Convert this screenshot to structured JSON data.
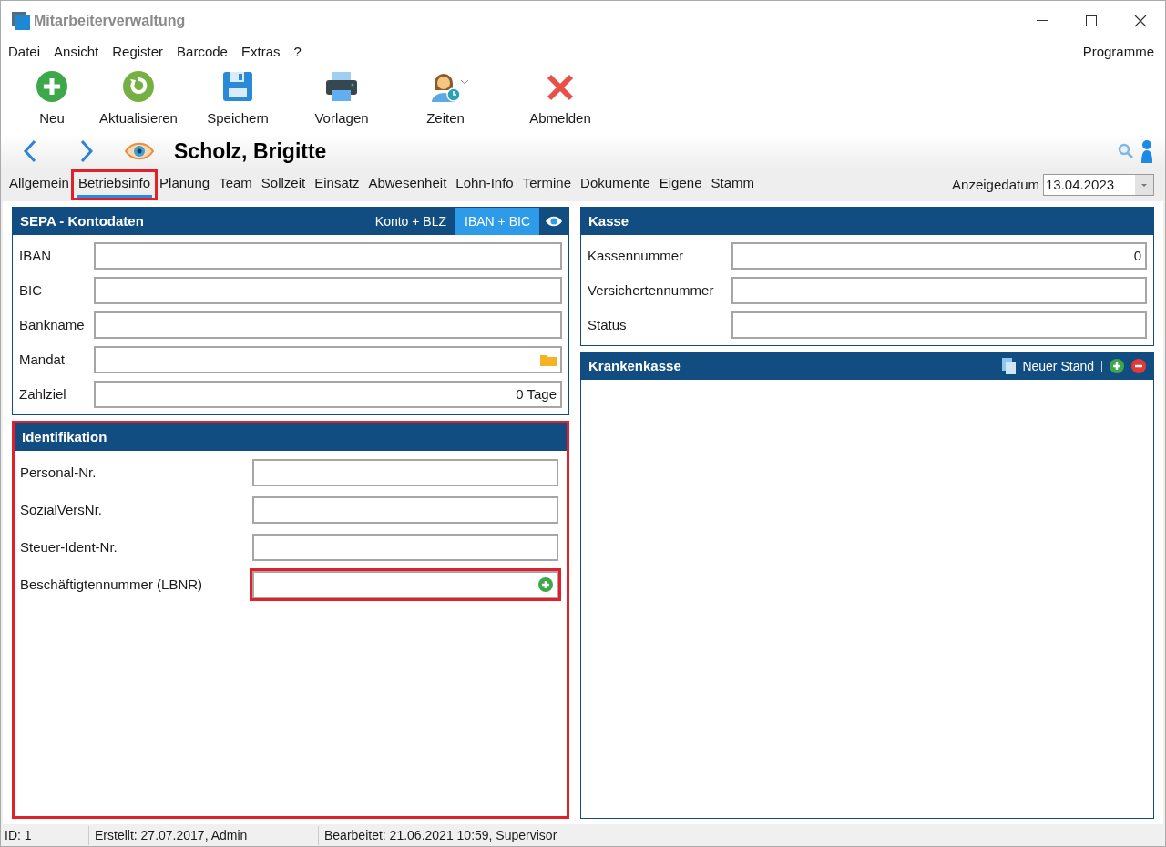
{
  "window": {
    "title": "Mitarbeiterverwaltung"
  },
  "menu": [
    "Datei",
    "Ansicht",
    "Register",
    "Barcode",
    "Extras",
    "?"
  ],
  "menu_right": "Programme",
  "toolbar": [
    {
      "kind": "new",
      "label": "Neu"
    },
    {
      "kind": "refresh",
      "label": "Aktualisieren"
    },
    {
      "kind": "save",
      "label": "Speichern"
    },
    {
      "kind": "print",
      "label": "Vorlagen"
    },
    {
      "kind": "times",
      "label": "Zeiten"
    },
    {
      "kind": "logout",
      "label": "Abmelden"
    }
  ],
  "record": {
    "name": "Scholz, Brigitte"
  },
  "tabs": [
    {
      "label": "Allgemein",
      "selected": false,
      "highlighted": false
    },
    {
      "label": "Betriebsinfo",
      "selected": true,
      "highlighted": true
    },
    {
      "label": "Planung",
      "selected": false,
      "highlighted": false
    },
    {
      "label": "Team",
      "selected": false,
      "highlighted": false
    },
    {
      "label": "Sollzeit",
      "selected": false,
      "highlighted": false
    },
    {
      "label": "Einsatz",
      "selected": false,
      "highlighted": false
    },
    {
      "label": "Abwesenheit",
      "selected": false,
      "highlighted": false
    },
    {
      "label": "Lohn-Info",
      "selected": false,
      "highlighted": false
    },
    {
      "label": "Termine",
      "selected": false,
      "highlighted": false
    },
    {
      "label": "Dokumente",
      "selected": false,
      "highlighted": false
    },
    {
      "label": "Eigene",
      "selected": false,
      "highlighted": false
    },
    {
      "label": "Stamm",
      "selected": false,
      "highlighted": false
    }
  ],
  "display_date": {
    "label": "Anzeigedatum",
    "value": "13.04.2023"
  },
  "sepa": {
    "title": "SEPA - Kontodaten",
    "modes": [
      {
        "label": "Konto + BLZ",
        "selected": false
      },
      {
        "label": "IBAN + BIC",
        "selected": true
      }
    ],
    "fields": [
      {
        "label": "IBAN",
        "kind": "text"
      },
      {
        "label": "BIC",
        "kind": "text"
      },
      {
        "label": "Bankname",
        "kind": "text"
      },
      {
        "label": "Mandat",
        "kind": "folder"
      },
      {
        "label": "Zahlziel",
        "value": "0 Tage",
        "kind": "text"
      }
    ]
  },
  "identifikation": {
    "title": "Identifikation",
    "highlighted": true,
    "fields": [
      {
        "label": "Personal-Nr.",
        "kind": "text",
        "highlighted": false
      },
      {
        "label": "SozialVersNr.",
        "kind": "text",
        "highlighted": false
      },
      {
        "label": "Steuer-Ident-Nr.",
        "kind": "text",
        "highlighted": false
      },
      {
        "label": "Beschäftigtennummer (LBNR)",
        "kind": "add",
        "highlighted": true
      }
    ]
  },
  "kasse": {
    "title": "Kasse",
    "fields": [
      {
        "label": "Kassennummer",
        "value": "0"
      },
      {
        "label": "Versichertennummer"
      },
      {
        "label": "Status"
      }
    ]
  },
  "krankenkasse": {
    "title": "Krankenkasse",
    "action": "Neuer Stand"
  },
  "status_bar": [
    "ID: 1",
    "Erstellt: 27.07.2017, Admin",
    "Bearbeitet: 21.06.2021 10:59, Supervisor"
  ]
}
